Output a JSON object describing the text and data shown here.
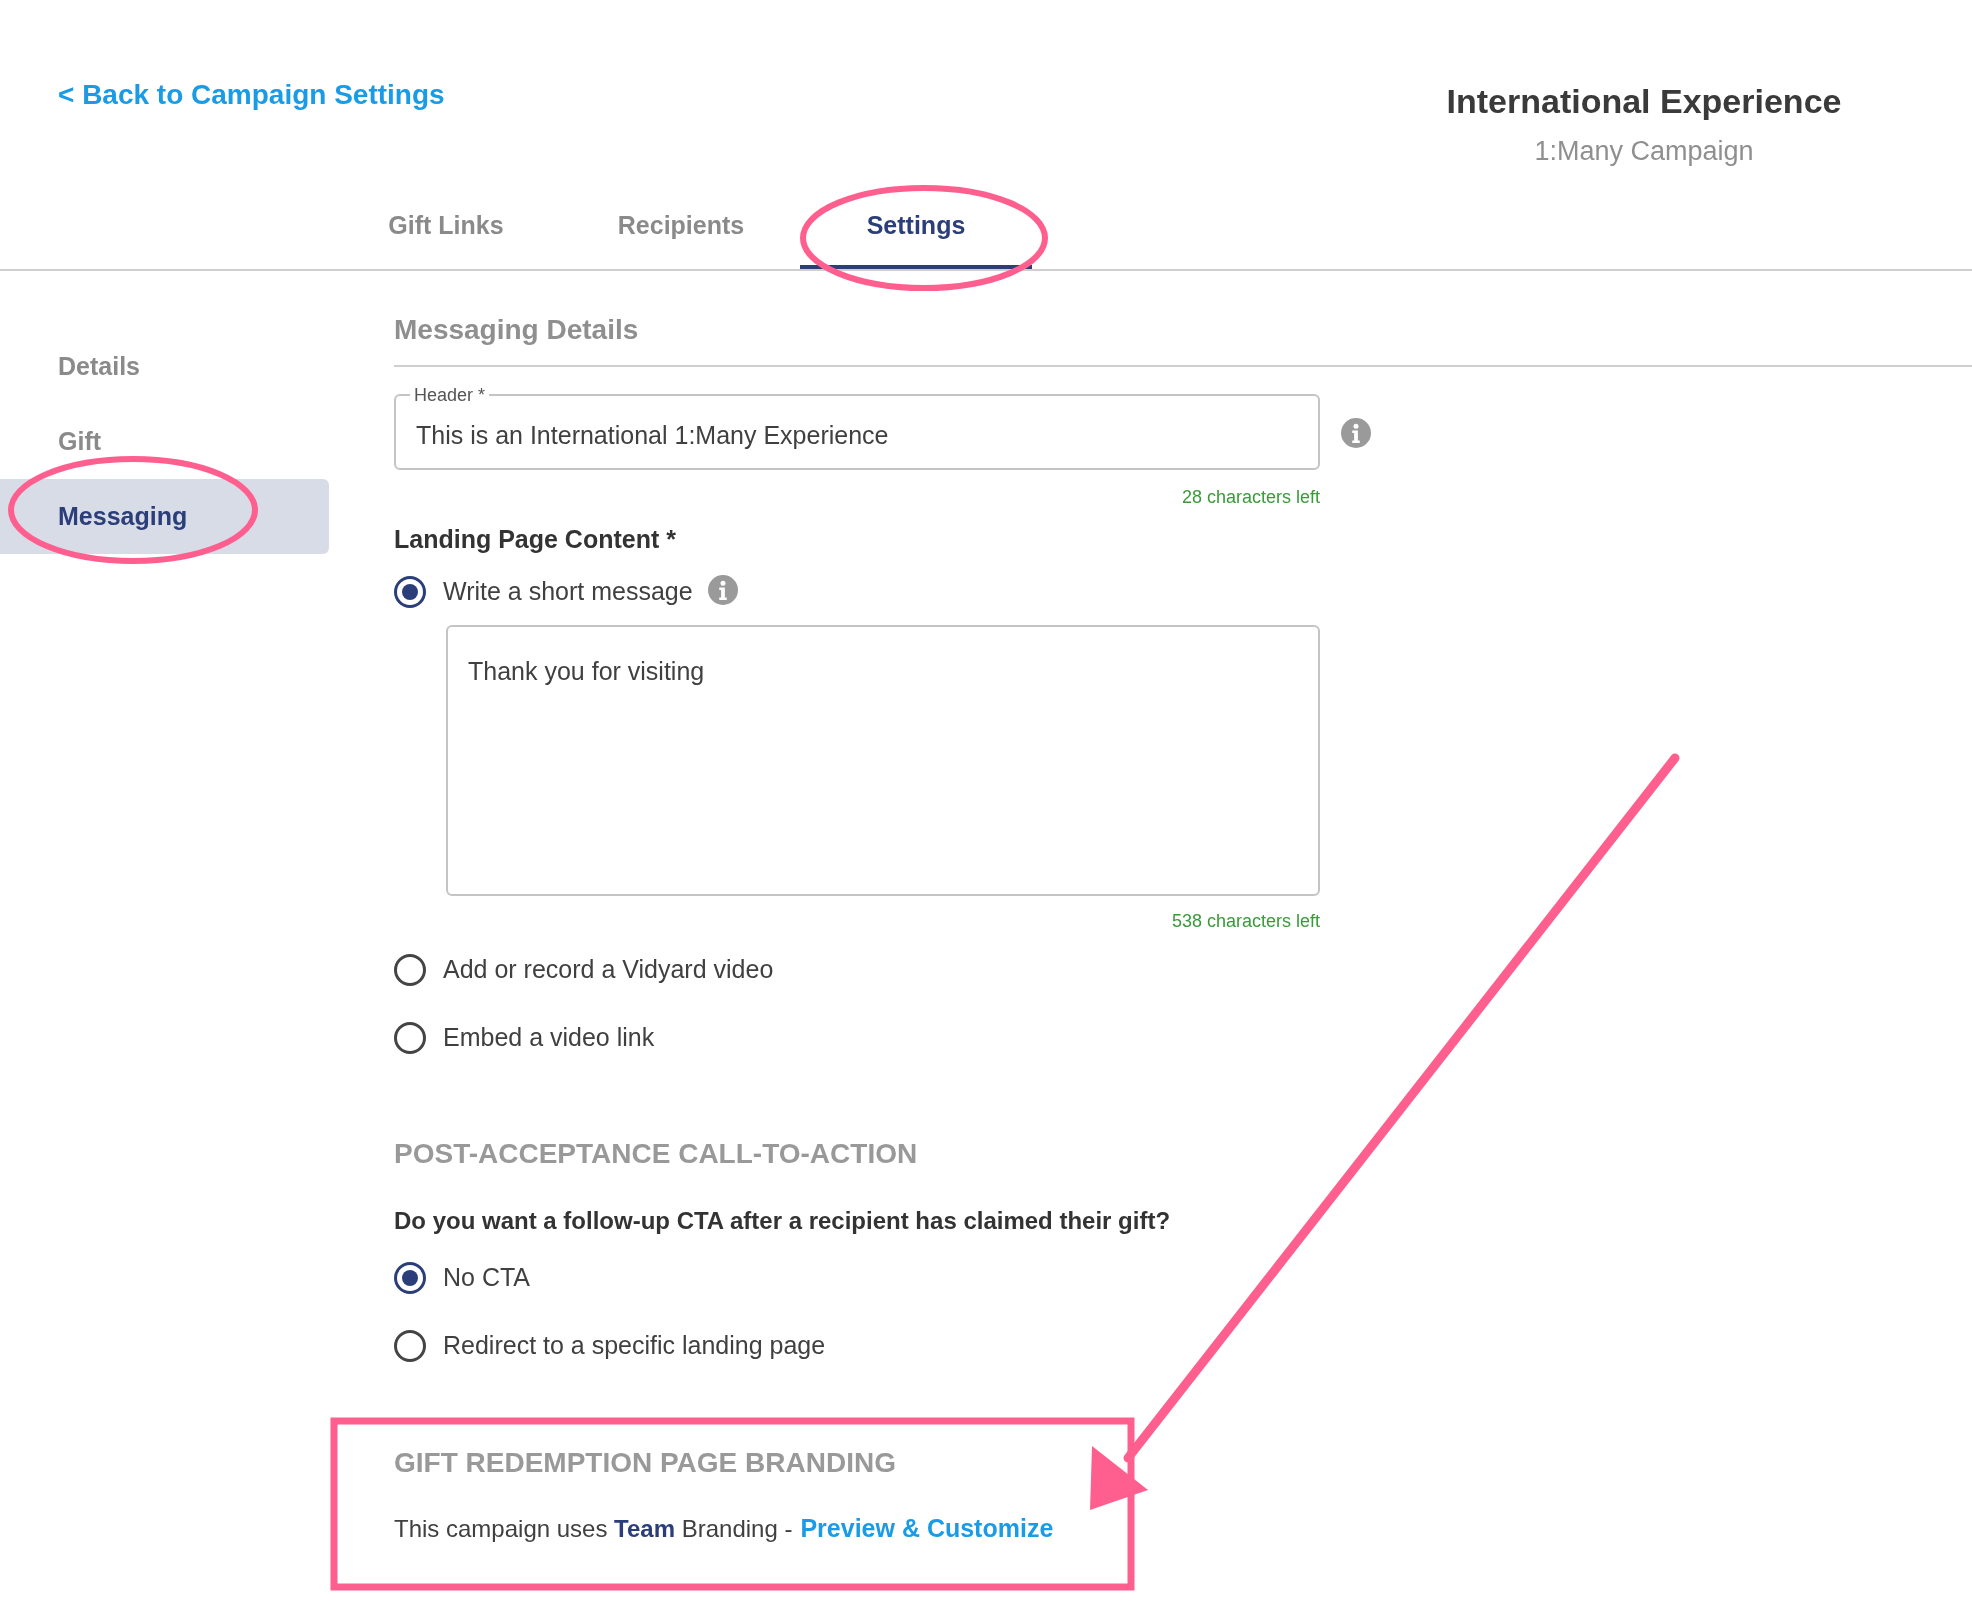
{
  "back_link": "< Back to Campaign Settings",
  "campaign": {
    "title": "International Experience",
    "subtitle": "1:Many Campaign"
  },
  "tabs": [
    {
      "label": "Gift Links",
      "selected": false
    },
    {
      "label": "Recipients",
      "selected": false
    },
    {
      "label": "Settings",
      "selected": true
    }
  ],
  "sidebar": {
    "items": [
      {
        "label": "Details",
        "selected": false
      },
      {
        "label": "Gift",
        "selected": false
      },
      {
        "label": "Messaging",
        "selected": true
      }
    ]
  },
  "messaging_details": {
    "heading": "Messaging Details",
    "header_field": {
      "label": "Header *",
      "value": "This is an International 1:Many Experience",
      "counter": "28 characters left"
    },
    "landing_page_content": {
      "label": "Landing Page Content *",
      "options": [
        {
          "label": "Write a short message",
          "selected": true,
          "message": {
            "value": "Thank you for visiting",
            "counter": "538 characters left"
          }
        },
        {
          "label": "Add or record a Vidyard video",
          "selected": false
        },
        {
          "label": "Embed a video link",
          "selected": false
        }
      ]
    }
  },
  "post_acceptance_cta": {
    "heading": "POST-ACCEPTANCE CALL-TO-ACTION",
    "question": "Do you want a follow-up CTA after a recipient has claimed their gift?",
    "options": [
      {
        "label": "No CTA",
        "selected": true
      },
      {
        "label": "Redirect to a specific landing page",
        "selected": false
      }
    ]
  },
  "branding": {
    "heading": "GIFT REDEMPTION PAGE BRANDING",
    "text": "This campaign uses **Team** Branding -",
    "link": "Preview & Customize"
  }
}
